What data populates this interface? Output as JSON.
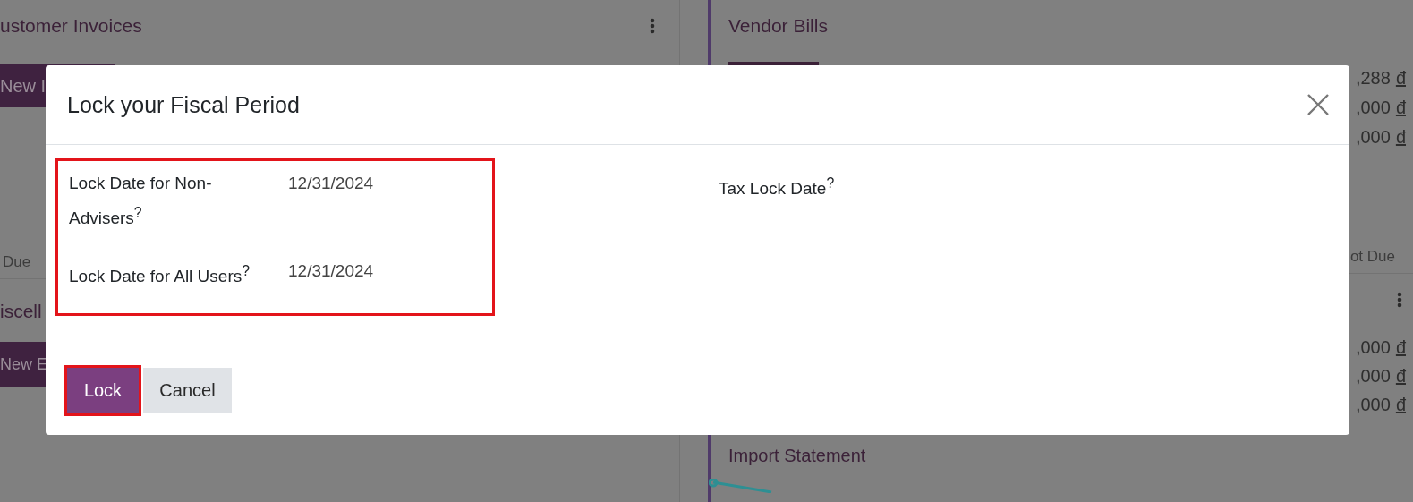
{
  "background": {
    "left_panel": {
      "title": "ustomer Invoices",
      "new_button": "New I",
      "column_label": "Due",
      "second_title": "iscell",
      "second_button": "New E"
    },
    "right_panel": {
      "title": "Vendor Bills",
      "amounts": [
        {
          "value": ",288",
          "currency": "đ"
        },
        {
          "value": ",000",
          "currency": "đ"
        },
        {
          "value": ",000",
          "currency": "đ"
        }
      ],
      "column_label": "ot Due",
      "second_amounts": [
        {
          "value": ",000",
          "currency": "đ"
        },
        {
          "value": ",000",
          "currency": "đ"
        },
        {
          "value": ",000",
          "currency": "đ"
        }
      ],
      "link": "Import Statement"
    }
  },
  "dialog": {
    "title": "Lock your Fiscal Period",
    "lock_dates": {
      "highlighted": true,
      "fields": [
        {
          "label": "Lock Date for Non-Advisers$^{?}$",
          "value": "12/31/2024"
        },
        {
          "label": "Lock Date for All Users$^{?}$",
          "value": "12/31/2024"
        }
      ]
    },
    "side_fields": [
      {
        "label": "Tax Lock Date$^{?}$"
      }
    ],
    "buttons": [
      {
        "label": "Lock",
        "kind": "primary",
        "highlighted": true
      },
      {
        "label": "Cancel",
        "kind": "secondary",
        "highlighted": false
      }
    ]
  }
}
